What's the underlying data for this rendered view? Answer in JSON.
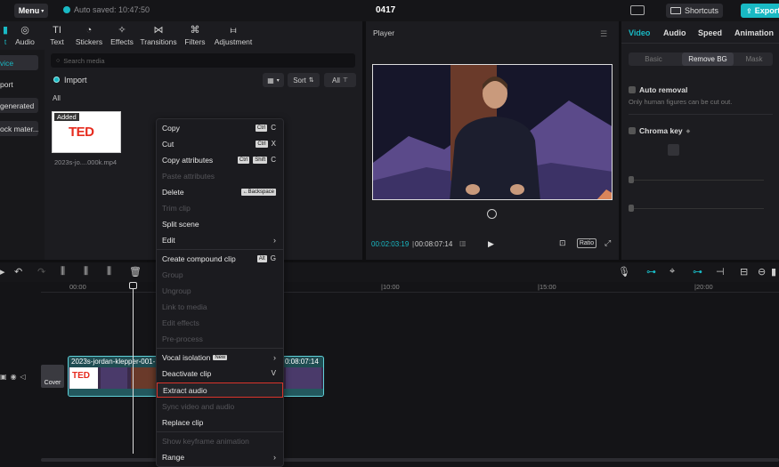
{
  "colors": {
    "accent": "#19b9c4",
    "highlight_border": "#d9342b",
    "ted_red": "#e62b1e"
  },
  "topbar": {
    "menu_label": "Menu",
    "autosave": "Auto saved: 10:47:50",
    "project_title": "0417",
    "shortcuts_label": "Shortcuts",
    "export_label": "Export"
  },
  "toolbar": {
    "tabs": [
      {
        "label": "Audio",
        "icon": "audio-icon"
      },
      {
        "label": "Text",
        "icon": "text-icon"
      },
      {
        "label": "Stickers",
        "icon": "stickers-icon"
      },
      {
        "label": "Effects",
        "icon": "effects-icon"
      },
      {
        "label": "Transitions",
        "icon": "transitions-icon"
      },
      {
        "label": "Filters",
        "icon": "filters-icon"
      },
      {
        "label": "Adjustment",
        "icon": "adjustment-icon"
      }
    ]
  },
  "sidebar": {
    "items": [
      "vice",
      "port",
      "generated",
      "ock mater..."
    ]
  },
  "media": {
    "search_placeholder": "Search media",
    "import_label": "Import",
    "sort_label": "Sort",
    "all_filter_label": "All",
    "all_label": "All",
    "thumb_badge": "Added",
    "thumb_logo": "TED",
    "thumb_name": "2023s-jo....000k.mp4"
  },
  "player": {
    "title": "Player",
    "current_time": "00:02:03:19",
    "separator": "|",
    "total_time": "00:08:07:14",
    "ratio_label": "Ratio"
  },
  "right_panel": {
    "tabs": [
      "Video",
      "Audio",
      "Speed",
      "Animation"
    ],
    "segments": [
      "Basic",
      "Remove BG",
      "Mask"
    ],
    "auto_removal_label": "Auto removal",
    "auto_removal_hint": "Only human figures can be cut out.",
    "chroma_key_label": "Chroma key"
  },
  "timeline": {
    "ruler": [
      "00:00",
      "|10:00",
      "|15:00",
      "|20:00"
    ],
    "clip_name": "2023s-jordan-klepper-001-",
    "clip_time": "0:08:07:14",
    "clip_logo": "TED",
    "cover_label": "Cover"
  },
  "context_menu": {
    "items": [
      {
        "label": "Copy",
        "keys": [
          "Ctrl"
        ],
        "letter": "C",
        "disabled": false
      },
      {
        "label": "Cut",
        "keys": [
          "Ctrl"
        ],
        "letter": "X",
        "disabled": false
      },
      {
        "label": "Copy attributes",
        "keys": [
          "Ctrl",
          "Shift"
        ],
        "letter": "C",
        "disabled": false
      },
      {
        "label": "Paste attributes",
        "keys": [],
        "letter": "",
        "disabled": true
      },
      {
        "label": "Delete",
        "keys": [
          "←Backspace"
        ],
        "letter": "",
        "disabled": false
      },
      {
        "label": "Trim clip",
        "keys": [],
        "letter": "",
        "disabled": true
      },
      {
        "label": "Split scene",
        "keys": [],
        "letter": "",
        "disabled": false
      },
      {
        "label": "Edit",
        "keys": [],
        "letter": "",
        "disabled": false,
        "submenu": true
      },
      {
        "label": "Create compound clip",
        "keys": [
          "Alt"
        ],
        "letter": "G",
        "disabled": false
      },
      {
        "label": "Group",
        "keys": [],
        "letter": "",
        "disabled": true
      },
      {
        "label": "Ungroup",
        "keys": [],
        "letter": "",
        "disabled": true
      },
      {
        "label": "Link to media",
        "keys": [],
        "letter": "",
        "disabled": true
      },
      {
        "label": "Edit effects",
        "keys": [],
        "letter": "",
        "disabled": true
      },
      {
        "label": "Pre-process",
        "keys": [],
        "letter": "",
        "disabled": true
      },
      {
        "label": "Vocal isolation",
        "badge": "New",
        "keys": [],
        "letter": "",
        "disabled": false,
        "submenu": true
      },
      {
        "label": "Deactivate clip",
        "keys": [],
        "letter": "V",
        "disabled": false
      },
      {
        "label": "Extract audio",
        "keys": [],
        "letter": "",
        "disabled": false,
        "highlight": true
      },
      {
        "label": "Sync video and audio",
        "keys": [],
        "letter": "",
        "disabled": true
      },
      {
        "label": "Replace clip",
        "keys": [],
        "letter": "",
        "disabled": false
      },
      {
        "label": "Show keyframe animation",
        "keys": [],
        "letter": "",
        "disabled": true
      },
      {
        "label": "Range",
        "keys": [],
        "letter": "",
        "disabled": false,
        "submenu": true
      }
    ]
  }
}
